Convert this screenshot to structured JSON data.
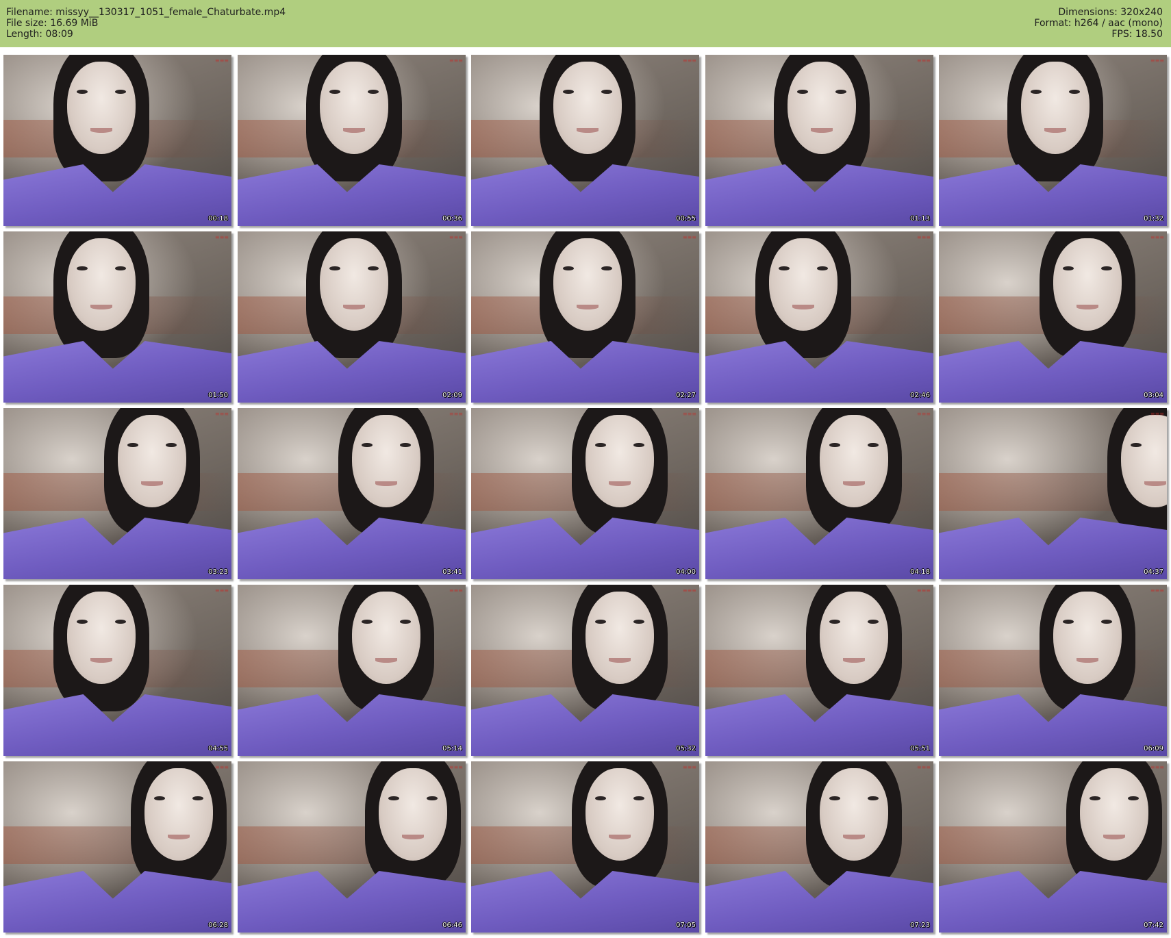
{
  "header": {
    "filename": "Filename: missyy__130317_1051_female_Chaturbate.mp4",
    "file_size": "File size: 16.69 MiB",
    "length": "Length: 08:09",
    "dimensions": "Dimensions: 320x240",
    "format": "Format: h264 / aac (mono)",
    "fps": "FPS: 18.50"
  },
  "colors": {
    "header_bg": "#b0ce7f",
    "shirt": "#7a68cc",
    "watermark": "#c0302c"
  },
  "thumbnails": [
    {
      "timestamp": "00:18",
      "pose": "center-left"
    },
    {
      "timestamp": "00:36",
      "pose": "center"
    },
    {
      "timestamp": "00:55",
      "pose": "center"
    },
    {
      "timestamp": "01:13",
      "pose": "center"
    },
    {
      "timestamp": "01:32",
      "pose": "center"
    },
    {
      "timestamp": "01:50",
      "pose": "center-left"
    },
    {
      "timestamp": "02:09",
      "pose": "center"
    },
    {
      "timestamp": "02:27",
      "pose": "center"
    },
    {
      "timestamp": "02:46",
      "pose": "center-left"
    },
    {
      "timestamp": "03:04",
      "pose": "right"
    },
    {
      "timestamp": "03:23",
      "pose": "right"
    },
    {
      "timestamp": "03:41",
      "pose": "right"
    },
    {
      "timestamp": "04:00",
      "pose": "right"
    },
    {
      "timestamp": "04:18",
      "pose": "right"
    },
    {
      "timestamp": "04:37",
      "pose": "arm"
    },
    {
      "timestamp": "04:55",
      "pose": "center-left"
    },
    {
      "timestamp": "05:14",
      "pose": "right"
    },
    {
      "timestamp": "05:32",
      "pose": "right"
    },
    {
      "timestamp": "05:51",
      "pose": "right"
    },
    {
      "timestamp": "06:09",
      "pose": "right"
    },
    {
      "timestamp": "06:28",
      "pose": "far-right"
    },
    {
      "timestamp": "06:46",
      "pose": "far-right"
    },
    {
      "timestamp": "07:05",
      "pose": "right"
    },
    {
      "timestamp": "07:23",
      "pose": "right"
    },
    {
      "timestamp": "07:42",
      "pose": "far-right"
    }
  ]
}
